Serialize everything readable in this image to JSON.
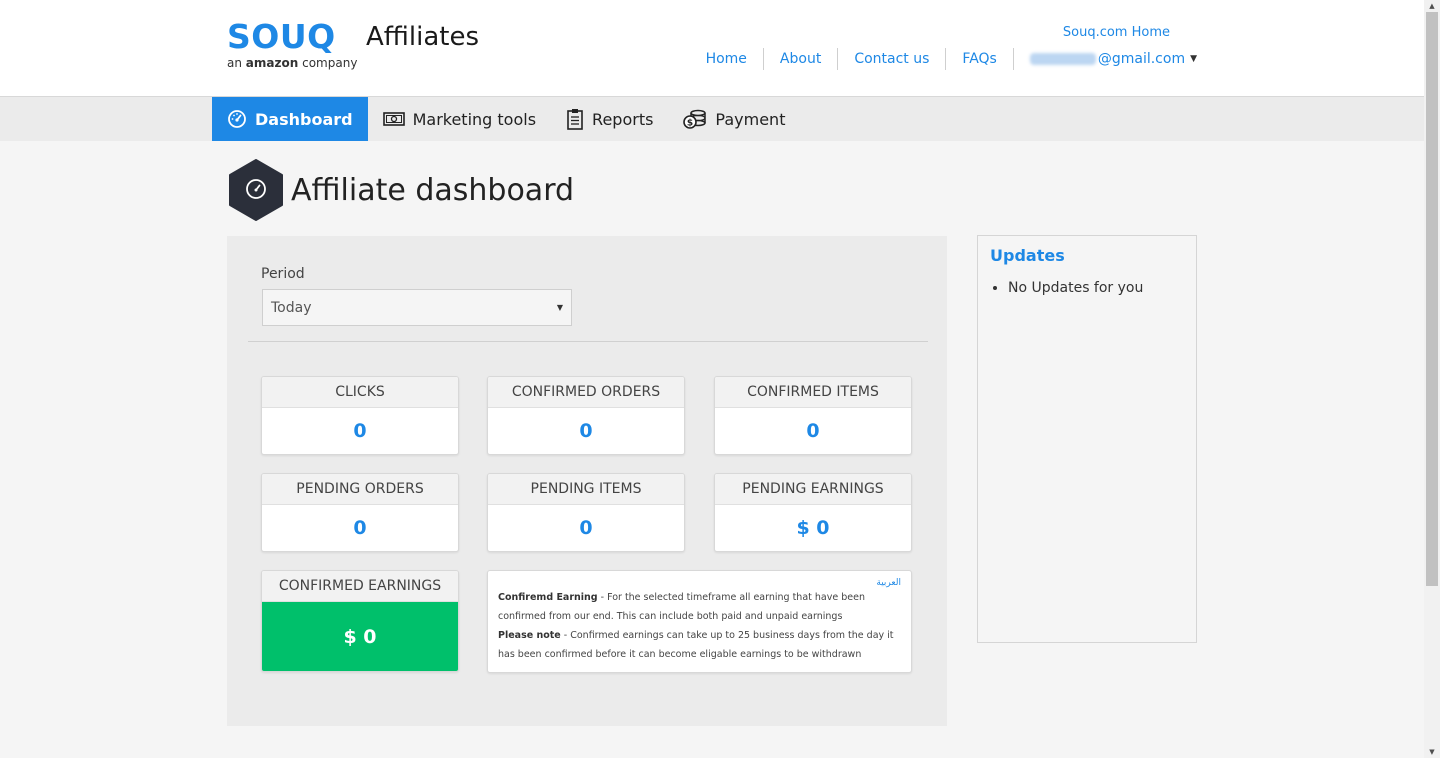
{
  "header": {
    "logo_word": "SOUQ",
    "logo_sub_prefix": "an",
    "logo_sub_brand": "amazon",
    "logo_sub_suffix": "company",
    "brand_title": "Affiliates",
    "home_link": "Souq.com Home",
    "nav": [
      "Home",
      "About",
      "Contact us",
      "FAQs"
    ],
    "email_suffix": "@gmail.com"
  },
  "tabs": [
    {
      "label": "Dashboard",
      "icon": "speedometer-icon",
      "active": true
    },
    {
      "label": "Marketing tools",
      "icon": "banknote-icon",
      "active": false
    },
    {
      "label": "Reports",
      "icon": "clipboard-icon",
      "active": false
    },
    {
      "label": "Payment",
      "icon": "coins-icon",
      "active": false
    }
  ],
  "page_title": "Affiliate dashboard",
  "period": {
    "label": "Period",
    "selected": "Today"
  },
  "cards": {
    "clicks": {
      "title": "CLICKS",
      "value": "0"
    },
    "confirmed_orders": {
      "title": "CONFIRMED ORDERS",
      "value": "0"
    },
    "confirmed_items": {
      "title": "CONFIRMED ITEMS",
      "value": "0"
    },
    "pending_orders": {
      "title": "PENDING ORDERS",
      "value": "0"
    },
    "pending_items": {
      "title": "PENDING ITEMS",
      "value": "0"
    },
    "pending_earnings": {
      "title": "PENDING EARNINGS",
      "value": "$ 0"
    },
    "confirmed_earnings": {
      "title": "CONFIRMED EARNINGS",
      "value": "$ 0"
    }
  },
  "note": {
    "lang_link": "العربية",
    "line1_bold": "Confiremd Earning",
    "line1_text": " - For the selected timeframe all earning that have been confirmed from our end. This can include both paid and unpaid earnings",
    "line2_bold": "Please note",
    "line2_text": " - Confirmed earnings can take up to 25 business days from the day it has been confirmed before it can become eligable earnings to be withdrawn"
  },
  "updates": {
    "title": "Updates",
    "items": [
      "No Updates for you"
    ]
  },
  "colors": {
    "accent": "#1e88e5",
    "green": "#00c06b",
    "dark_hex": "#2b2f3a"
  }
}
